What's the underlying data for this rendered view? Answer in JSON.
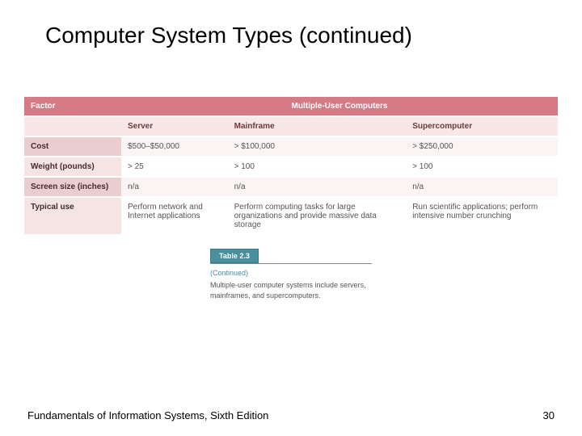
{
  "title": "Computer System Types (continued)",
  "table": {
    "factor_header": "Factor",
    "span_header": "Multiple-User Computers",
    "columns": [
      "Server",
      "Mainframe",
      "Supercomputer"
    ],
    "rows": [
      {
        "label": "Cost",
        "cells": [
          "$500–$50,000",
          "> $100,000",
          "> $250,000"
        ]
      },
      {
        "label": "Weight (pounds)",
        "cells": [
          "> 25",
          "> 100",
          "> 100"
        ]
      },
      {
        "label": "Screen size (inches)",
        "cells": [
          "n/a",
          "n/a",
          "n/a"
        ]
      },
      {
        "label": "Typical use",
        "cells": [
          "Perform network and Internet applications",
          "Perform computing tasks for large organizations and provide massive data storage",
          "Run scientific applications; perform intensive number crunching"
        ]
      }
    ]
  },
  "caption": {
    "tag": "Table 2.3",
    "continued": "(Continued)",
    "text": "Multiple-user computer systems include servers, mainframes, and supercomputers."
  },
  "footer": {
    "left": "Fundamentals of Information Systems, Sixth Edition",
    "right": "30"
  }
}
